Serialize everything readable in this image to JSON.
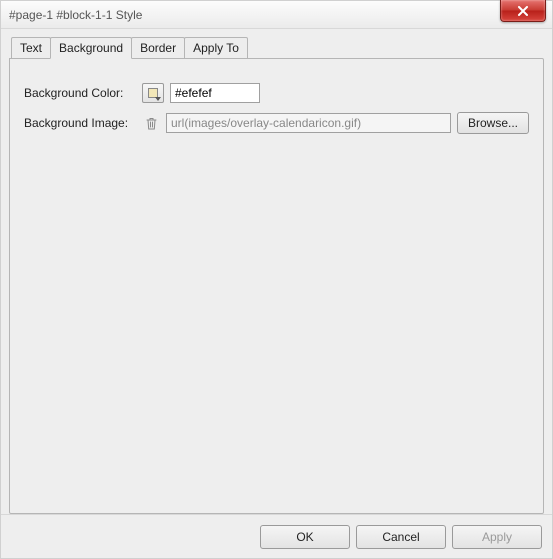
{
  "window": {
    "title": "#page-1 #block-1-1 Style"
  },
  "tabs": {
    "text": "Text",
    "background": "Background",
    "border": "Border",
    "apply_to": "Apply To"
  },
  "fields": {
    "bg_color_label": "Background Color:",
    "bg_color_value": "#efefef",
    "bg_image_label": "Background Image:",
    "bg_image_value": "url(images/overlay-calendaricon.gif)",
    "browse": "Browse..."
  },
  "buttons": {
    "ok": "OK",
    "cancel": "Cancel",
    "apply": "Apply"
  }
}
